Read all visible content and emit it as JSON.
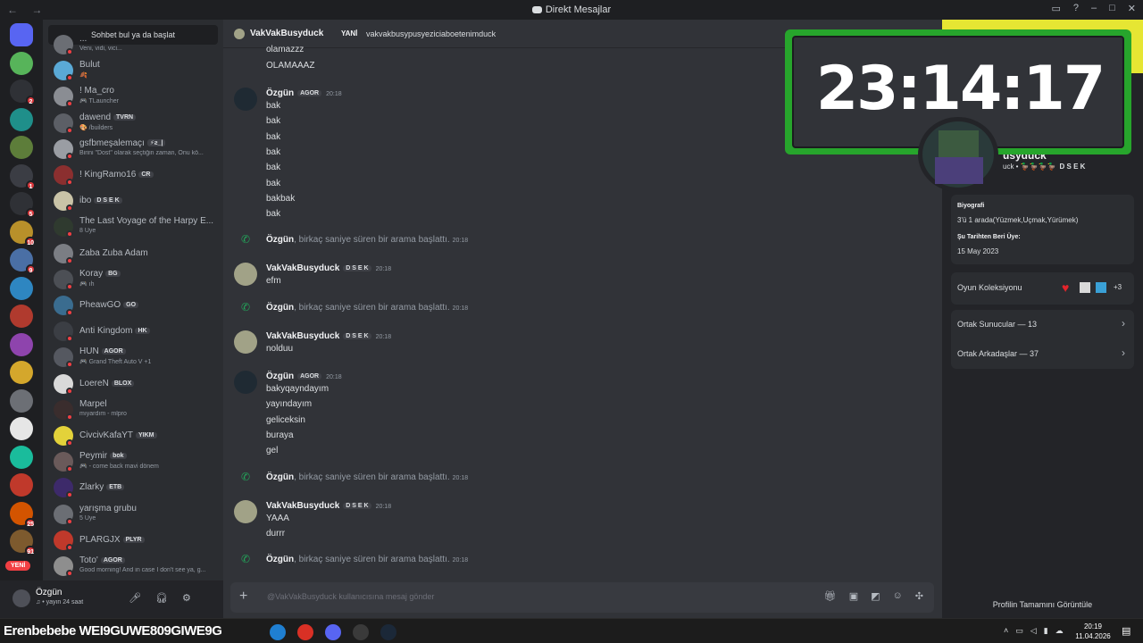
{
  "window": {
    "title": "Direkt Mesajlar",
    "nav": "← →"
  },
  "colors": {
    "accent_online": "#23a55a",
    "dnd": "#f23f43",
    "clock_frame": "#27a52c",
    "banner": "#e6e633"
  },
  "rail": {
    "servers": [
      {
        "icon": "discord-home-icon",
        "color": "#5865f2",
        "badge": ""
      },
      {
        "icon": "server-green-icon",
        "color": "#57b45a",
        "badge": ""
      },
      {
        "icon": "server-yetkili-icon",
        "color": "#2f3136",
        "badge": "2"
      },
      {
        "icon": "server-teal-icon",
        "color": "#1f8f8a",
        "badge": ""
      },
      {
        "icon": "server-minecraft-icon",
        "color": "#5d7d3a",
        "badge": ""
      },
      {
        "icon": "server-bank-icon",
        "color": "#3b3d44",
        "badge": "1"
      },
      {
        "icon": "server-bot-icon",
        "color": "#2f3136",
        "badge": "5"
      },
      {
        "icon": "server-game-icon",
        "color": "#b8902a",
        "badge": "10"
      },
      {
        "icon": "server-pixel-icon",
        "color": "#4a6fa5",
        "badge": "9"
      },
      {
        "icon": "server-blue-icon",
        "color": "#2e86c1",
        "badge": ""
      },
      {
        "icon": "server-list-icon",
        "color": "#b03a2e",
        "badge": ""
      },
      {
        "icon": "server-brawl-icon",
        "color": "#8e44ad",
        "badge": ""
      },
      {
        "icon": "server-yellow-icon",
        "color": "#d4a72c",
        "badge": ""
      },
      {
        "icon": "server-anime-icon",
        "color": "#6c6f75",
        "badge": ""
      },
      {
        "icon": "server-white-icon",
        "color": "#e6e6e6",
        "badge": ""
      },
      {
        "icon": "server-cyan-icon",
        "color": "#1abc9c",
        "badge": ""
      },
      {
        "icon": "server-red-icon",
        "color": "#c0392b",
        "badge": ""
      },
      {
        "icon": "server-orange-icon",
        "color": "#d35400",
        "badge": "25"
      },
      {
        "icon": "server-neon-icon",
        "color": "#7d5a2e",
        "badge": "91"
      }
    ],
    "new_label": "YENİ"
  },
  "dm_list": {
    "search_label": "Sohbet bul ya da başlat",
    "items": [
      {
        "name": "...",
        "sub": "Veni, vidi, vici...",
        "tag": "",
        "avatar": "#6b6e74"
      },
      {
        "name": "Bulut",
        "sub": "🍂",
        "tag": "",
        "avatar": "#5aa9d6"
      },
      {
        "name": "! Ma_cro",
        "sub": "🎮 TLauncher",
        "tag": "",
        "avatar": "#8a8d93"
      },
      {
        "name": "dawend",
        "sub": "🎨 /builders",
        "tag": "TVRN",
        "avatar": "#5c5f66"
      },
      {
        "name": "gsfbmeşalemaçı",
        "sub": "Birini \"Dost\" olarak seçtiğin zaman, Onu kö...",
        "tag": "⚡ƨ_|",
        "avatar": "#9a9da3"
      },
      {
        "name": "! KingRamo16",
        "sub": "",
        "tag": "CR",
        "avatar": "#8b2f2f"
      },
      {
        "name": "ibo",
        "sub": "",
        "tag": "D S E K",
        "avatar": "#c9c3a7"
      },
      {
        "name": "The Last Voyage of the Harpy E...",
        "sub": "8 Üye",
        "tag": "",
        "avatar": "#2f3a2f"
      },
      {
        "name": "Zaba Zuba Adam",
        "sub": "",
        "tag": "",
        "avatar": "#7b7e84"
      },
      {
        "name": "Koray",
        "sub": "🎮 ıh",
        "tag": "BG",
        "avatar": "#4c4f55"
      },
      {
        "name": "PheawGO",
        "sub": "",
        "tag": "GO",
        "avatar": "#3a6c8f"
      },
      {
        "name": "Anti Kingdom",
        "sub": "",
        "tag": "HK",
        "avatar": "#3b3e44"
      },
      {
        "name": "HUN",
        "sub": "🎮 Grand Theft Auto V +1",
        "tag": "AGOR",
        "avatar": "#555860"
      },
      {
        "name": "LoereN",
        "sub": "",
        "tag": "BLOX",
        "avatar": "#d9d9d9"
      },
      {
        "name": "Marpel",
        "sub": "mıyardım - mlpro",
        "tag": "",
        "avatar": "#3a2d2d"
      },
      {
        "name": "CivcivKafaYT",
        "sub": "",
        "tag": "YIKM",
        "avatar": "#e3d23a"
      },
      {
        "name": "Peymir",
        "sub": "🎮 - come back mavi dönem",
        "tag": "bok",
        "avatar": "#6a5a5a"
      },
      {
        "name": "Zlarky",
        "sub": "",
        "tag": "ETB",
        "avatar": "#3d2a6a"
      },
      {
        "name": "yarışma grubu",
        "sub": "5 Üye",
        "tag": "",
        "avatar": "#6b6e74"
      },
      {
        "name": "PLARGJX",
        "sub": "",
        "tag": "PLYR",
        "avatar": "#c0392b"
      },
      {
        "name": "Toto'",
        "sub": "Good morning! And in case I don't see ya, g...",
        "tag": "AGOR",
        "avatar": "#8e8e8e"
      }
    ]
  },
  "user_panel": {
    "name": "Özgün",
    "status": "♫ • yayın 24 saat"
  },
  "chat": {
    "recipient": "VakVakBusyduck",
    "new_label": "YANİ",
    "topic": "vakvakbusypusyeziciaboetenimduck",
    "top_lines": [
      "olamazzz",
      "OLAMAAAZ"
    ],
    "groups": [
      {
        "author": "Özgün",
        "tag": "AGOR",
        "time": "20:18",
        "lines": [
          "bak",
          "bak",
          "bak",
          "bak",
          "bak",
          "bak",
          "bakbak",
          "bak"
        ],
        "avatar": "#1f2a33"
      },
      {
        "call": true,
        "author": "Özgün",
        "text": ", birkaç saniye süren bir arama başlattı.",
        "time": "20:18"
      },
      {
        "author": "VakVakBusyduck",
        "tag": "D S E K",
        "time": "20:18",
        "lines": [
          "efm"
        ],
        "avatar": "#a1a287"
      },
      {
        "call": true,
        "author": "Özgün",
        "text": ", birkaç saniye süren bir arama başlattı.",
        "time": "20:18"
      },
      {
        "author": "VakVakBusyduck",
        "tag": "D S E K",
        "time": "20:18",
        "lines": [
          "nolduu"
        ],
        "avatar": "#a1a287"
      },
      {
        "author": "Özgün",
        "tag": "AGOR",
        "time": "20:18",
        "lines": [
          "bakyqayndayım",
          "yayındayım",
          "geliceksin",
          "buraya",
          "gel"
        ],
        "avatar": "#1f2a33"
      },
      {
        "call": true,
        "author": "Özgün",
        "text": ", birkaç saniye süren bir arama başlattı.",
        "time": "20:18"
      },
      {
        "author": "VakVakBusyduck",
        "tag": "D S E K",
        "time": "20:18",
        "lines": [
          "YAAA",
          "durrr"
        ],
        "avatar": "#a1a287"
      },
      {
        "call": true,
        "author": "Özgün",
        "text": ", birkaç saniye süren bir arama başlattı.",
        "time": "20:18"
      }
    ],
    "composer_placeholder": "@VakVakBusyduck kullanıcısına mesaj gönder"
  },
  "profile": {
    "name": "usyduck",
    "handle": "uck • 🦆🦆🦆🦆",
    "tag": "D S E K",
    "bio_label": "Biyografi",
    "bio": "3'ü 1 arada(Yüzmek,Uçmak,Yürümek)",
    "member_since_label": "Şu Tarihten Beri Üye:",
    "member_since": "15 May 2023",
    "game_collection": "Oyun Koleksiyonu",
    "game_more": "+3",
    "mutual_servers": "Ortak Sunucular — 13",
    "mutual_friends": "Ortak Arkadaşlar — 37",
    "view_full": "Profilin Tamamını Görüntüle"
  },
  "clock": {
    "time": "23:14:17"
  },
  "taskbar": {
    "ticker": "Erenbebebe  WEI9GUWE809GIWE9G",
    "time": "20:19",
    "date": "11.04.2026",
    "apps": [
      {
        "icon": "edge-icon",
        "color": "#1f7fd1"
      },
      {
        "icon": "chrome-icon",
        "color": "#d93025"
      },
      {
        "icon": "discord-icon",
        "color": "#5865f2"
      },
      {
        "icon": "obs-icon",
        "color": "#3a3a3a"
      },
      {
        "icon": "steam-icon",
        "color": "#1b2838"
      }
    ]
  }
}
